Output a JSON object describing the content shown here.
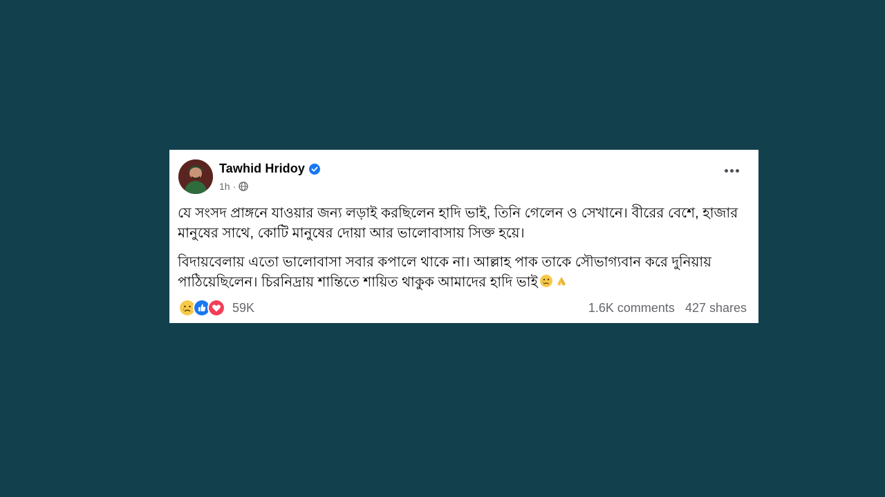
{
  "post": {
    "author": "Tawhid Hridoy",
    "time": "1h",
    "time_separator": "·",
    "paragraphs": [
      "যে সংসদ প্রাঙ্গনে যাওয়ার জন্য লড়াই করছিলেন হাদি ভাই, তিনি গেলেন ও সেখানে। বীরের বেশে, হাজার মানুষের সাথে, কোটি মানুষের দোয়া আর ভালোবাসায় সিক্ত হয়ে।",
      "বিদায়বেলায় এতো ভালোবাসা সবার কপালে থাকে না। আল্লাহ পাক তাকে সৌভাগ্যবান করে দুনিয়ায় পাঠিয়েছিলেন। চিরনিদ্রায় শান্তিতে শায়িত থাকুক আমাদের হাদি ভাই"
    ],
    "inline_emojis": [
      "sad-tear-emoji",
      "praying-hands-emoji"
    ]
  },
  "reactions": {
    "icons": [
      "sad-reaction",
      "like-reaction",
      "love-reaction"
    ],
    "count": "59K"
  },
  "stats": {
    "comments": "1.6K comments",
    "shares": "427 shares"
  },
  "colors": {
    "background": "#13404d",
    "card": "#ffffff",
    "verified": "#1877f2",
    "text": "#050505",
    "muted": "#65676b"
  }
}
